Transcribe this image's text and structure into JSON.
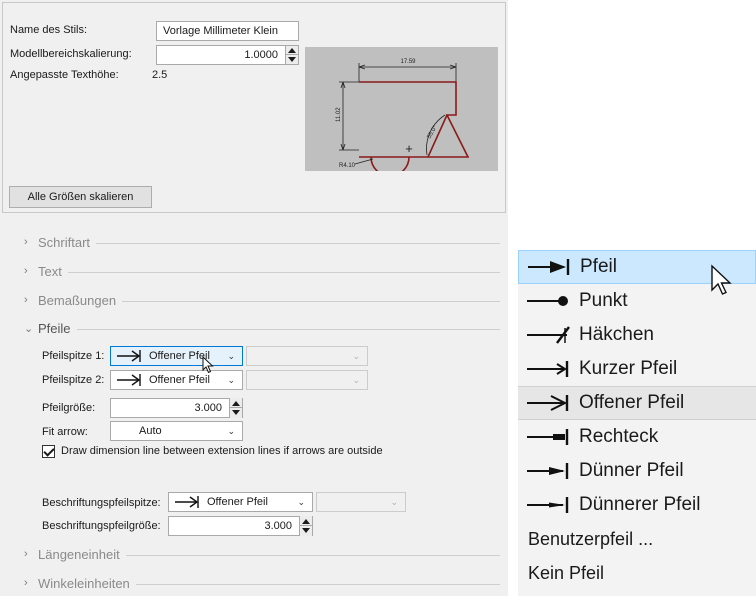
{
  "top": {
    "style_name_label": "Name des Stils:",
    "style_name_value": "Vorlage Millimeter Klein",
    "model_scale_label": "Modellbereichskalierung:",
    "model_scale_value": "1.0000",
    "text_height_label": "Angepasste Texthöhe:",
    "text_height_value": "2.5",
    "scale_all_button": "Alle Größen skalieren"
  },
  "preview": {
    "dim_top": "17.59",
    "dim_left": "11.02",
    "dim_angle": "55.0°",
    "dim_radius": "R4.10",
    "center_mark": "+"
  },
  "sections": {
    "font": "Schriftart",
    "text": "Text",
    "dimensions": "Bemaßungen",
    "arrows": "Pfeile",
    "length_unit": "Längeneinheit",
    "angle_units": "Winkeleinheiten"
  },
  "arrows": {
    "arrowhead1_label": "Pfeilspitze 1:",
    "arrowhead1_value": "Offener Pfeil",
    "arrowhead2_label": "Pfeilspitze 2:",
    "arrowhead2_value": "Offener Pfeil",
    "arrow_size_label": "Pfeilgröße:",
    "arrow_size_value": "3.000",
    "fit_arrow_label": "Fit arrow:",
    "fit_arrow_value": "Auto",
    "draw_dim_line_label": "Draw dimension line between extension lines if arrows are outside",
    "draw_dim_line_checked": true,
    "leader_arrow_label": "Beschriftungspfeilspitze:",
    "leader_arrow_value": "Offener Pfeil",
    "leader_size_label": "Beschriftungspfeilgröße:",
    "leader_size_value": "3.000"
  },
  "menu": {
    "items": [
      {
        "label": "Pfeil",
        "icon": "filled-arrow-icon",
        "state": "highlighted"
      },
      {
        "label": "Punkt",
        "icon": "dot-arrow-icon"
      },
      {
        "label": "Häkchen",
        "icon": "tick-arrow-icon"
      },
      {
        "label": "Kurzer Pfeil",
        "icon": "short-arrow-icon"
      },
      {
        "label": "Offener Pfeil",
        "icon": "open-arrow-icon",
        "state": "selected"
      },
      {
        "label": "Rechteck",
        "icon": "rectangle-arrow-icon"
      },
      {
        "label": "Dünner Pfeil",
        "icon": "thin-arrow-icon"
      },
      {
        "label": "Dünnerer Pfeil",
        "icon": "thinner-arrow-icon"
      },
      {
        "label": "Benutzerpfeil ..."
      },
      {
        "label": "Kein Pfeil"
      }
    ]
  },
  "colors": {
    "panel_bg": "#f0f0f0",
    "highlight": "#cce8ff",
    "drawing_line": "#8b1a1a",
    "preview_bg": "#bfbfbf"
  }
}
